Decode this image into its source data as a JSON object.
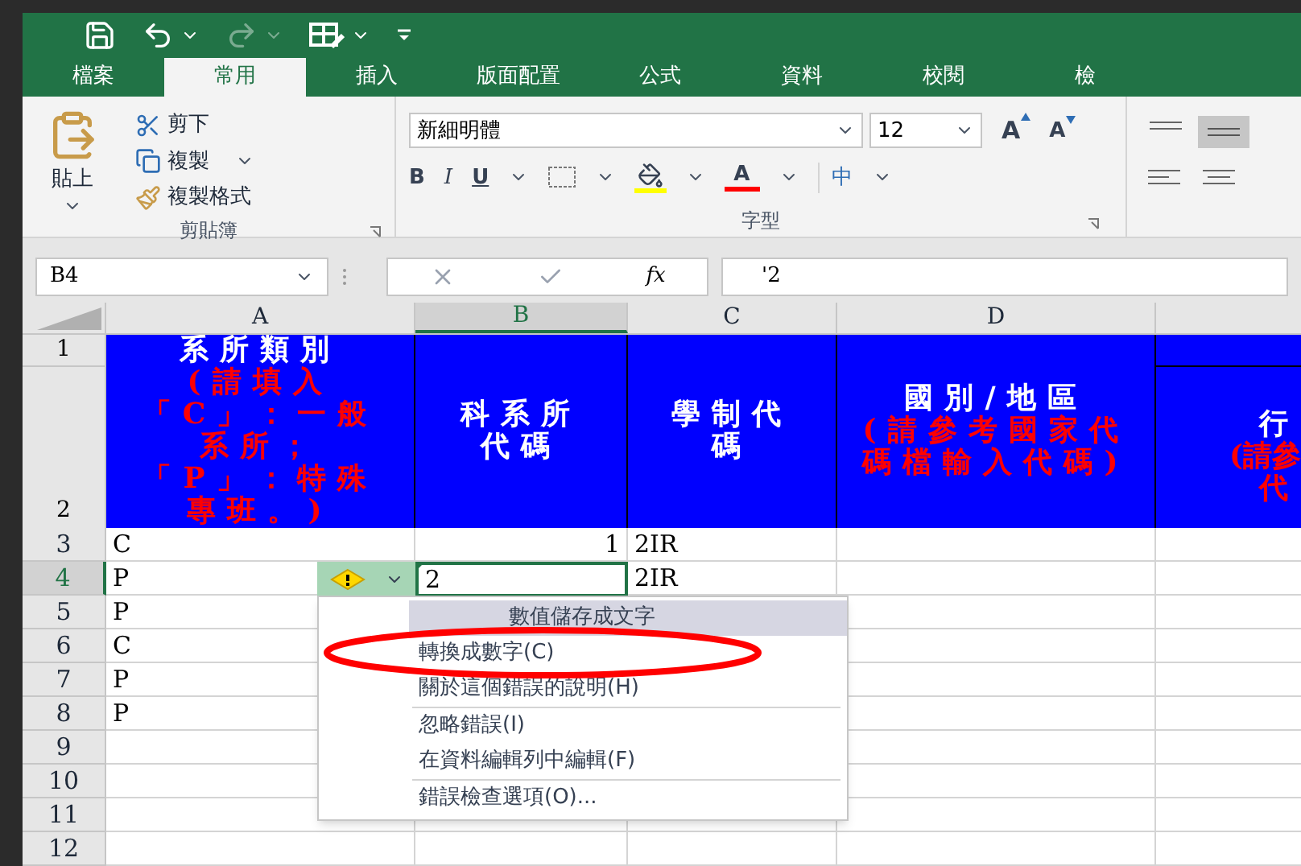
{
  "quick_access": {
    "redo_disabled": true
  },
  "tabs": [
    {
      "label": "檔案",
      "selected": false
    },
    {
      "label": "常用",
      "selected": true
    },
    {
      "label": "插入",
      "selected": false
    },
    {
      "label": "版面配置",
      "selected": false
    },
    {
      "label": "公式",
      "selected": false
    },
    {
      "label": "資料",
      "selected": false
    },
    {
      "label": "校閱",
      "selected": false
    },
    {
      "label": "檢",
      "selected": false
    }
  ],
  "clipboard": {
    "paste": "貼上",
    "cut": "剪下",
    "copy": "複製",
    "format_painter": "複製格式",
    "label": "剪貼簿"
  },
  "font": {
    "font_name": "新細明體",
    "font_size": "12",
    "grow": "A",
    "shrink": "A",
    "bold": "B",
    "italic": "I",
    "underline": "U",
    "font_color": "A",
    "phonetic": "中",
    "label": "字型"
  },
  "formula_bar": {
    "name_box": "B4",
    "function_label": "fx",
    "value": "'2"
  },
  "columns": [
    {
      "label": "A",
      "selected": false
    },
    {
      "label": "B",
      "selected": true
    },
    {
      "label": "C",
      "selected": false
    },
    {
      "label": "D",
      "selected": false
    }
  ],
  "header_rows": [
    "1",
    "2"
  ],
  "header_cells": [
    {
      "title": "系所類別",
      "note": "(請填入「C」：一般系所；「P」：特殊專班。)"
    },
    {
      "title": "科系所代碼"
    },
    {
      "title": "學制代碼"
    },
    {
      "title": "國別/地區",
      "note": "(請參考國家代碼檔輸入代碼)"
    },
    {
      "title": "行",
      "note": "(請參",
      "note_2": "代"
    }
  ],
  "rows": [
    {
      "header": "3",
      "selected": false,
      "column_a": "C",
      "column_b": "1",
      "column_b_numeric": true,
      "column_c": "2IR"
    },
    {
      "header": "4",
      "selected": true,
      "column_a": "P",
      "column_b": "2",
      "column_b_numeric": false,
      "column_c": "2IR"
    },
    {
      "header": "5",
      "selected": false,
      "column_a": "P"
    },
    {
      "header": "6",
      "selected": false,
      "column_a": "C"
    },
    {
      "header": "7",
      "selected": false,
      "column_a": "P"
    },
    {
      "header": "8",
      "selected": false,
      "column_a": "P"
    },
    {
      "header": "9",
      "selected": false
    },
    {
      "header": "10",
      "selected": false
    },
    {
      "header": "11",
      "selected": false
    },
    {
      "header": "12",
      "selected": false
    }
  ],
  "error_menu": {
    "items": [
      {
        "label": "數值儲存成文字",
        "kind": "title",
        "separator_before": false
      },
      {
        "label": "轉換成數字(C)",
        "kind": "item",
        "separator_before": false
      },
      {
        "label": "關於這個錯誤的說明(H)",
        "kind": "item",
        "separator_before": false
      },
      {
        "label": "忽略錯誤(I)",
        "kind": "item",
        "separator_before": true
      },
      {
        "label": "在資料編輯列中編輯(F)",
        "kind": "item",
        "separator_before": false
      },
      {
        "label": "錯誤檢查選項(O)...",
        "kind": "item",
        "separator_before": true
      }
    ]
  }
}
